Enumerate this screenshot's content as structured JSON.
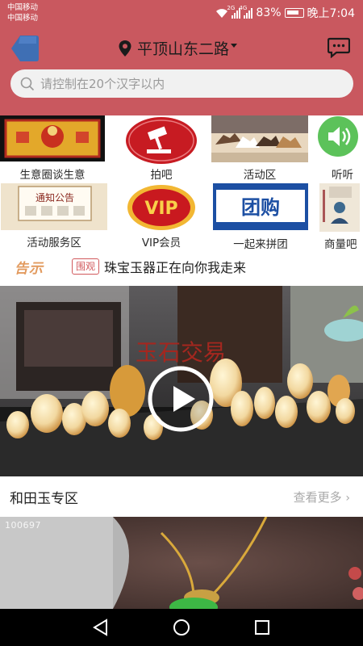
{
  "status_bar": {
    "carrier_line1": "中国移动",
    "carrier_line2": "中国移动",
    "net1": "2G",
    "net2": "4G",
    "battery": "83%",
    "time": "晚上7:04"
  },
  "nav": {
    "back_icon": "back-arrow-icon",
    "location": "平顶山东二路",
    "location_icon": "location-pin-icon",
    "chat_icon": "message-icon"
  },
  "search": {
    "placeholder": "请控制在20个汉字以内",
    "icon": "search-icon"
  },
  "categories": [
    {
      "label": "生意圈谈生意"
    },
    {
      "label": "拍吧"
    },
    {
      "label": "活动区"
    },
    {
      "label": "听听"
    },
    {
      "label": "活动服务区"
    },
    {
      "label": "VIP会员"
    },
    {
      "label": "一起来拼团"
    },
    {
      "label": "商量吧"
    }
  ],
  "thumb_text": {
    "notice_board": "通知公告",
    "vip": "VIP",
    "group_buy": "团购"
  },
  "notice": {
    "logo": "告示",
    "tag": "围观",
    "text": "珠宝玉器正在向你我走来"
  },
  "banner": {
    "caption": "玉石交易",
    "play_icon": "play-icon"
  },
  "section": {
    "title": "和田玉专区",
    "more": "查看更多",
    "more_icon": "chevron-right-icon"
  },
  "product": {
    "code": "100697"
  },
  "colors": {
    "header": "#c9585f",
    "accent": "#d1595c",
    "back_button": "#3f6fb4"
  }
}
